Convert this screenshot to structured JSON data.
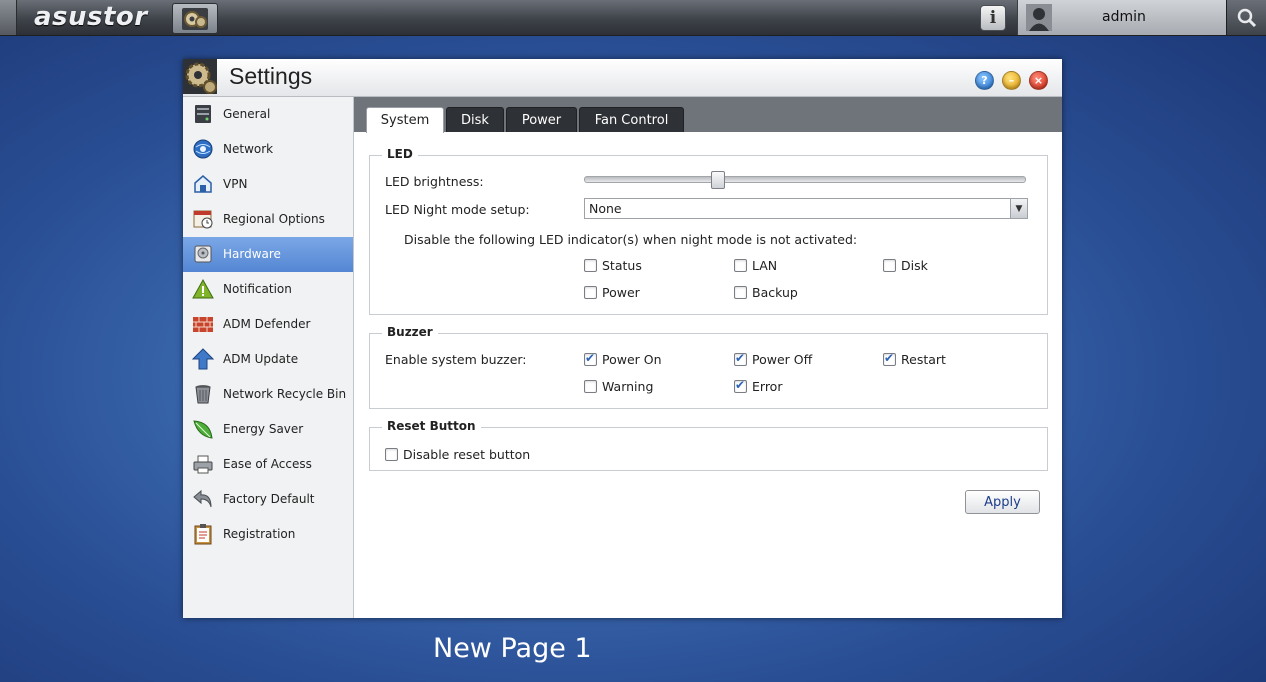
{
  "topbar": {
    "logo": "asustor",
    "info_glyph": "i",
    "username": "admin"
  },
  "window": {
    "title": "Settings",
    "controls": {
      "help": "?",
      "minimize": "–",
      "close": "×"
    }
  },
  "sidebar": {
    "items": [
      {
        "label": "General",
        "icon": "server-icon"
      },
      {
        "label": "Network",
        "icon": "globe-icon"
      },
      {
        "label": "VPN",
        "icon": "vpn-house-icon"
      },
      {
        "label": "Regional Options",
        "icon": "calendar-clock-icon"
      },
      {
        "label": "Hardware",
        "icon": "hard-drive-icon",
        "active": true
      },
      {
        "label": "Notification",
        "icon": "warning-icon"
      },
      {
        "label": "ADM Defender",
        "icon": "firewall-icon"
      },
      {
        "label": "ADM Update",
        "icon": "up-arrow-icon"
      },
      {
        "label": "Network Recycle Bin",
        "icon": "trash-bin-icon"
      },
      {
        "label": "Energy Saver",
        "icon": "leaf-icon"
      },
      {
        "label": "Ease of Access",
        "icon": "printer-icon"
      },
      {
        "label": "Factory Default",
        "icon": "undo-icon"
      },
      {
        "label": "Registration",
        "icon": "clipboard-icon"
      }
    ]
  },
  "tabs": [
    {
      "label": "System",
      "active": true
    },
    {
      "label": "Disk"
    },
    {
      "label": "Power"
    },
    {
      "label": "Fan Control"
    }
  ],
  "led": {
    "legend": "LED",
    "brightness_label": "LED brightness:",
    "brightness_fraction": 0.3,
    "night_mode_label": "LED Night mode setup:",
    "night_mode_value": "None",
    "disable_text": "Disable the following LED indicator(s) when night mode is not activated:",
    "indicators": [
      {
        "label": "Status",
        "checked": false
      },
      {
        "label": "LAN",
        "checked": false
      },
      {
        "label": "Disk",
        "checked": false
      },
      {
        "label": "Power",
        "checked": false
      },
      {
        "label": "Backup",
        "checked": false
      }
    ]
  },
  "buzzer": {
    "legend": "Buzzer",
    "enable_label": "Enable system buzzer:",
    "options": [
      {
        "label": "Power On",
        "checked": true
      },
      {
        "label": "Power Off",
        "checked": true
      },
      {
        "label": "Restart",
        "checked": true
      },
      {
        "label": "Warning",
        "checked": false
      },
      {
        "label": "Error",
        "checked": true
      }
    ]
  },
  "reset": {
    "legend": "Reset Button",
    "disable_label": "Disable reset button",
    "checked": false
  },
  "apply_label": "Apply",
  "page_label": "New Page 1"
}
